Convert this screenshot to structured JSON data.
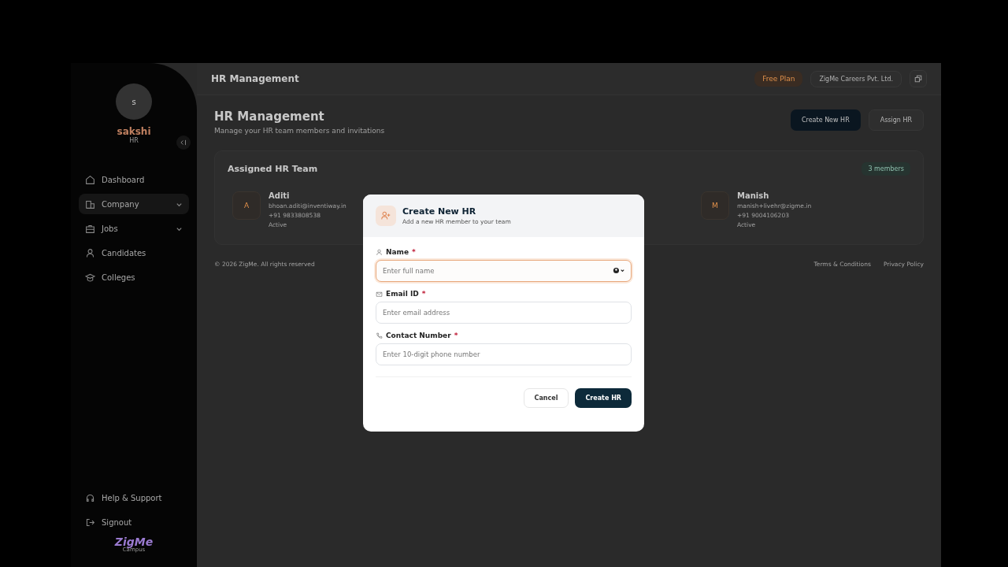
{
  "sidebar": {
    "avatar_initial": "s",
    "user_name": "sakshi",
    "user_role": "HR",
    "items": [
      {
        "label": "Dashboard",
        "selected": false,
        "has_submenu": false
      },
      {
        "label": "Company",
        "selected": true,
        "has_submenu": true
      },
      {
        "label": "Jobs",
        "selected": false,
        "has_submenu": true
      },
      {
        "label": "Candidates",
        "selected": false,
        "has_submenu": false
      },
      {
        "label": "Colleges",
        "selected": false,
        "has_submenu": false
      }
    ],
    "footer_items": [
      {
        "label": "Help & Support"
      },
      {
        "label": "Signout"
      }
    ],
    "logo": {
      "text": "ZigMe",
      "subtext": "Campus"
    }
  },
  "topbar": {
    "title": "HR Management",
    "plan": "Free Plan",
    "company": "ZigMe Careers Pvt. Ltd."
  },
  "page": {
    "title": "HR Management",
    "subtitle": "Manage your HR team members and invitations",
    "buttons": [
      {
        "label": "Create New HR",
        "kind": "primary"
      },
      {
        "label": "Assign HR",
        "kind": "secondary"
      }
    ]
  },
  "team": {
    "title": "Assigned HR Team",
    "count": "3 members",
    "members": [
      {
        "initial": "A",
        "name": "Aditi",
        "email": "bhoan.aditi@inventiway.in",
        "phone": "+91 9833808538",
        "status": "Active"
      },
      {
        "initial": "M",
        "name": "Manish",
        "email": "manish+livehr@zigme.in",
        "phone": "+91 9004106203",
        "status": "Active"
      }
    ]
  },
  "footer": {
    "copyright": "© 2026 ZigMe. All rights reserved",
    "links": [
      "Terms & Conditions",
      "Privacy Policy"
    ]
  },
  "dialog": {
    "title": "Create New HR",
    "subtitle": "Add a new HR member to your team",
    "fields": [
      {
        "label": "Name",
        "required_mark": "*",
        "placeholder": "Enter full name",
        "focused": true
      },
      {
        "label": "Email ID",
        "required_mark": "*",
        "placeholder": "Enter email address",
        "focused": false
      },
      {
        "label": "Contact Number",
        "required_mark": "*",
        "placeholder": "Enter 10-digit phone number",
        "focused": false
      }
    ],
    "buttons": [
      {
        "label": "Cancel",
        "kind": "secondary"
      },
      {
        "label": "Create HR",
        "kind": "primary"
      }
    ]
  }
}
